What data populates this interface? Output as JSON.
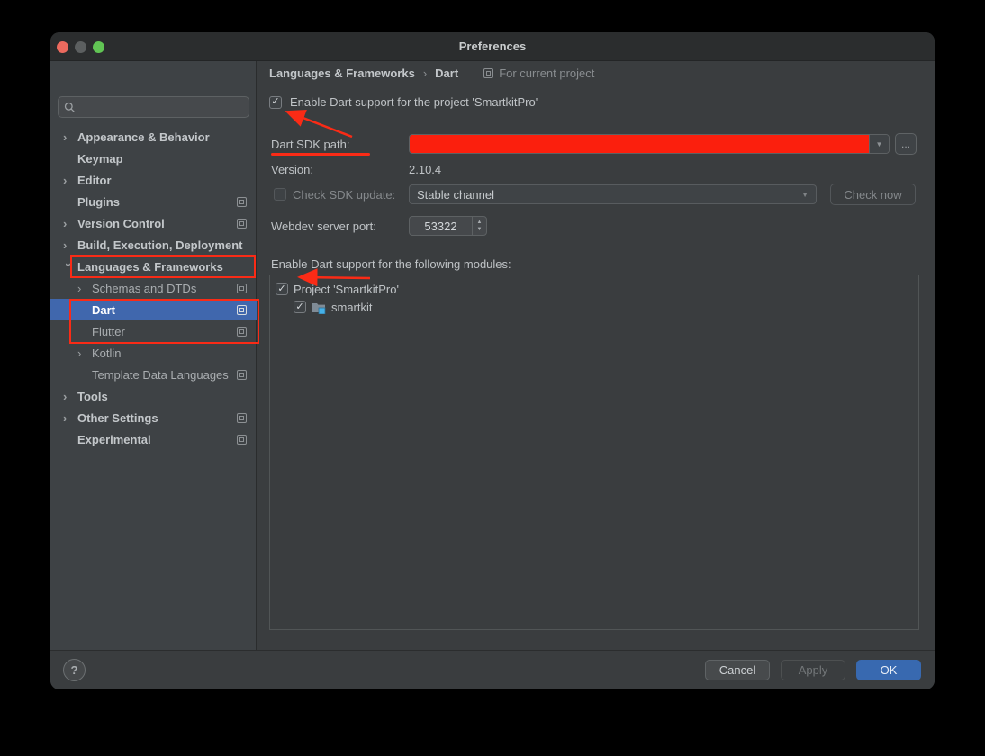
{
  "window": {
    "title": "Preferences"
  },
  "icons": {
    "chevron_glyph": "›",
    "check_glyph": "✓",
    "dropdown_arrow_glyph": "▼",
    "step_up_glyph": "▲",
    "step_down_glyph": "▼"
  },
  "sidebar": {
    "search": {
      "placeholder": "",
      "value": ""
    },
    "items": [
      {
        "label": "Appearance & Behavior",
        "bold": true,
        "chevron": "right",
        "level": 0,
        "proj_icon": false,
        "selected": false
      },
      {
        "label": "Keymap",
        "bold": true,
        "chevron": null,
        "level": 0,
        "proj_icon": false,
        "selected": false
      },
      {
        "label": "Editor",
        "bold": true,
        "chevron": "right",
        "level": 0,
        "proj_icon": false,
        "selected": false
      },
      {
        "label": "Plugins",
        "bold": true,
        "chevron": null,
        "level": 0,
        "proj_icon": true,
        "selected": false
      },
      {
        "label": "Version Control",
        "bold": true,
        "chevron": "right",
        "level": 0,
        "proj_icon": true,
        "selected": false
      },
      {
        "label": "Build, Execution, Deployment",
        "bold": true,
        "chevron": "right",
        "level": 0,
        "proj_icon": false,
        "selected": false
      },
      {
        "label": "Languages & Frameworks",
        "bold": true,
        "chevron": "down",
        "level": 0,
        "proj_icon": false,
        "selected": false
      },
      {
        "label": "Schemas and DTDs",
        "bold": false,
        "chevron": "right",
        "level": 1,
        "proj_icon": true,
        "selected": false
      },
      {
        "label": "Dart",
        "bold": false,
        "chevron": null,
        "level": 1,
        "proj_icon": true,
        "selected": true
      },
      {
        "label": "Flutter",
        "bold": false,
        "chevron": null,
        "level": 1,
        "proj_icon": true,
        "selected": false
      },
      {
        "label": "Kotlin",
        "bold": false,
        "chevron": "right",
        "level": 1,
        "proj_icon": false,
        "selected": false
      },
      {
        "label": "Template Data Languages",
        "bold": false,
        "chevron": null,
        "level": 1,
        "proj_icon": true,
        "selected": false
      },
      {
        "label": "Tools",
        "bold": true,
        "chevron": "right",
        "level": 0,
        "proj_icon": false,
        "selected": false
      },
      {
        "label": "Other Settings",
        "bold": true,
        "chevron": "right",
        "level": 0,
        "proj_icon": true,
        "selected": false
      },
      {
        "label": "Experimental",
        "bold": true,
        "chevron": null,
        "level": 0,
        "proj_icon": true,
        "selected": false
      }
    ]
  },
  "breadcrumb": {
    "section": "Languages & Frameworks",
    "separator": "›",
    "page": "Dart",
    "scope_label": "For current project"
  },
  "main": {
    "enable_project": {
      "label": "Enable Dart support for the project 'SmartkitPro'",
      "checked": true
    },
    "sdk_path": {
      "label": "Dart SDK path:",
      "value": "",
      "browse_label": "..."
    },
    "version": {
      "label": "Version:",
      "value": "2.10.4"
    },
    "sdk_update": {
      "label": "Check SDK update:",
      "checked": false,
      "channel_value": "Stable channel",
      "button_label": "Check now"
    },
    "webdev_port": {
      "label": "Webdev server port:",
      "value": "53322"
    },
    "modules": {
      "label": "Enable Dart support for the following modules:",
      "rows": [
        {
          "label": "Project 'SmartkitPro'",
          "checked": true,
          "level": 0,
          "module_icon": false
        },
        {
          "label": "smartkit",
          "checked": true,
          "level": 1,
          "module_icon": true
        }
      ]
    }
  },
  "footer": {
    "help_label": "?",
    "cancel_label": "Cancel",
    "apply_label": "Apply",
    "ok_label": "OK"
  },
  "colors": {
    "annotation_red": "#fa2b16",
    "sdk_field_red_fill": "#fb1f0d",
    "selection_blue": "#4067ad",
    "ok_blue": "#3869b0"
  }
}
